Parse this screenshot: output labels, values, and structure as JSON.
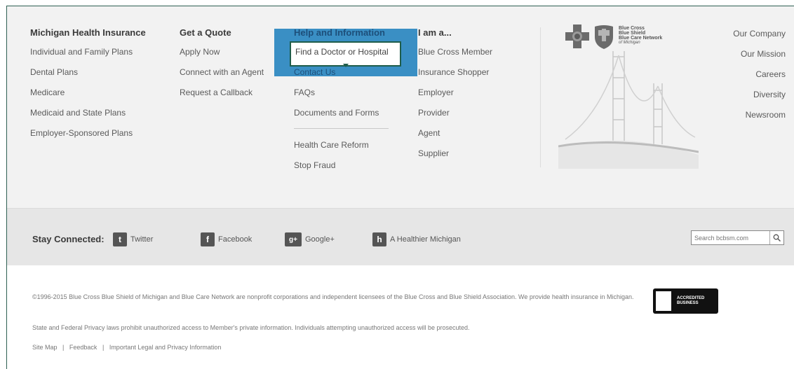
{
  "columns": {
    "michigan": {
      "heading": "Michigan Health Insurance",
      "links": [
        "Individual and Family Plans",
        "Dental Plans",
        "Medicare",
        "Medicaid and State Plans",
        "Employer-Sponsored Plans"
      ]
    },
    "quote": {
      "heading": "Get a Quote",
      "links": [
        "Apply Now",
        "Connect with an Agent",
        "Request a Callback"
      ]
    },
    "help": {
      "heading": "Help and Information",
      "links": [
        "Find a Doctor or Hospital",
        "Contact Us",
        "FAQs",
        "Documents and Forms"
      ],
      "links2": [
        "Health Care Reform",
        "Stop Fraud"
      ]
    },
    "iam": {
      "heading": "I am a...",
      "links": [
        "Blue Cross Member",
        "Insurance Shopper",
        "Employer",
        "Provider",
        "Agent",
        "Supplier"
      ]
    }
  },
  "logo": {
    "line1": "Blue Cross",
    "line2": "Blue Shield",
    "line3": "Blue Care Network",
    "line4": "of Michigan"
  },
  "company_links": [
    "Our Company",
    "Our Mission",
    "Careers",
    "Diversity",
    "Newsroom"
  ],
  "social": {
    "label": "Stay Connected:",
    "items": [
      "Twitter",
      "Facebook",
      "Google+",
      "A Healthier Michigan"
    ]
  },
  "search": {
    "placeholder": "Search bcbsm.com"
  },
  "legal": {
    "copyright": "©1996-2015 Blue Cross Blue Shield of Michigan and Blue Care Network are nonprofit corporations and independent licensees of the Blue Cross and Blue Shield Association. We provide health insurance in Michigan.",
    "privacy": "State and Federal Privacy laws prohibit unauthorized access to Member's private information. Individuals attempting unauthorized access will be prosecuted.",
    "links": [
      "Site Map",
      "Feedback",
      "Important Legal and Privacy Information"
    ],
    "separator": "|"
  },
  "bbb": {
    "line1": "ACCREDITED",
    "line2": "BUSINESS"
  },
  "colors": {
    "highlight": "#3a8fc4",
    "focus_border": "#1f5d4b"
  }
}
